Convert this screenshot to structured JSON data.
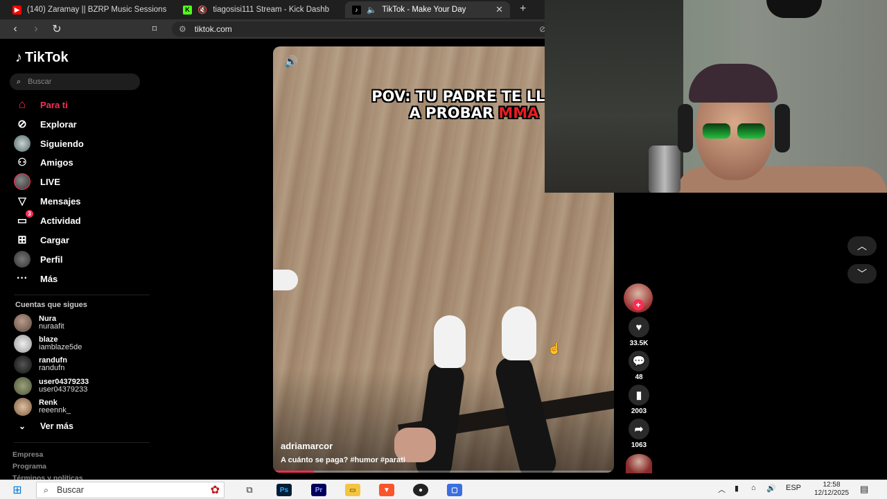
{
  "browser": {
    "tabs": [
      {
        "title": "(140) Zaramay || BZRP Music Sessions",
        "icon": "youtube-icon",
        "color": "#ff0000"
      },
      {
        "title": "tiagosisi111 Stream - Kick Dashb",
        "icon": "kick-icon",
        "color": "#53fc18"
      },
      {
        "title": "TikTok - Make Your Day",
        "icon": "tiktok-icon",
        "color": "#ffffff"
      }
    ],
    "url": "tiktok.com"
  },
  "sidebar": {
    "logo": "TikTok",
    "search_placeholder": "Buscar",
    "nav": [
      {
        "label": "Para ti",
        "icon": "home-icon"
      },
      {
        "label": "Explorar",
        "icon": "compass-icon"
      },
      {
        "label": "Siguiendo",
        "icon": "following-avatar-icon"
      },
      {
        "label": "Amigos",
        "icon": "friends-icon"
      },
      {
        "label": "LIVE",
        "icon": "live-avatar-icon"
      },
      {
        "label": "Mensajes",
        "icon": "send-icon"
      },
      {
        "label": "Actividad",
        "icon": "activity-icon",
        "badge": "3"
      },
      {
        "label": "Cargar",
        "icon": "upload-icon"
      },
      {
        "label": "Perfil",
        "icon": "profile-avatar-icon"
      },
      {
        "label": "Más",
        "icon": "more-dots-icon"
      }
    ],
    "following_title": "Cuentas que sigues",
    "accounts": [
      {
        "name": "Nura",
        "handle": "nuraafit"
      },
      {
        "name": "blaze",
        "handle": "iamblaze5de"
      },
      {
        "name": "randufn",
        "handle": "randufn"
      },
      {
        "name": "user04379233",
        "handle": "user04379233"
      },
      {
        "name": "Renk",
        "handle": "reeennk_"
      }
    ],
    "see_more": "Ver más",
    "footer": [
      "Empresa",
      "Programa",
      "Términos y políticas"
    ]
  },
  "video": {
    "caption_line1": "POV: TU PADRE TE LLEVA",
    "caption_line2a": "A PROBAR",
    "caption_line2b": "MMA",
    "author": "adriamarcor",
    "description": "A cuánto se paga? #humor #parati",
    "progress": 0.12
  },
  "actions": {
    "likes": "33.5K",
    "comments": "48",
    "saves": "2003",
    "shares": "1063"
  },
  "taskbar": {
    "search_placeholder": "Buscar",
    "language": "ESP",
    "time": "12:58",
    "date": "12/12/2025"
  }
}
